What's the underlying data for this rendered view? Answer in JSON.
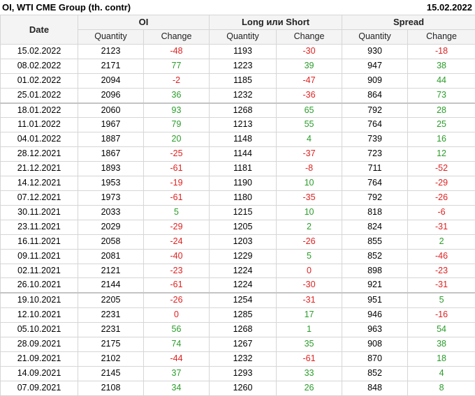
{
  "header": {
    "title": "OI, WTI CME Group (th. contr)",
    "date": "15.02.2022"
  },
  "table": {
    "date_header": "Date",
    "groups": [
      "OI",
      "Long или Short",
      "Spread"
    ],
    "sub_headers": [
      "Quantity",
      "Change",
      "Quantity",
      "Change",
      "Quantity",
      "Change"
    ],
    "rows": [
      [
        "15.02.2022",
        "2123",
        "-48",
        "1193",
        "-30",
        "930",
        "-18"
      ],
      [
        "08.02.2022",
        "2171",
        "77",
        "1223",
        "39",
        "947",
        "38"
      ],
      [
        "01.02.2022",
        "2094",
        "-2",
        "1185",
        "-47",
        "909",
        "44"
      ],
      [
        "25.01.2022",
        "2096",
        "36",
        "1232",
        "-36",
        "864",
        "73"
      ],
      [
        "18.01.2022",
        "2060",
        "93",
        "1268",
        "65",
        "792",
        "28"
      ],
      [
        "11.01.2022",
        "1967",
        "79",
        "1213",
        "55",
        "764",
        "25"
      ],
      [
        "04.01.2022",
        "1887",
        "20",
        "1148",
        "4",
        "739",
        "16"
      ],
      [
        "28.12.2021",
        "1867",
        "-25",
        "1144",
        "-37",
        "723",
        "12"
      ],
      [
        "21.12.2021",
        "1893",
        "-61",
        "1181",
        "-8",
        "711",
        "-52"
      ],
      [
        "14.12.2021",
        "1953",
        "-19",
        "1190",
        "10",
        "764",
        "-29"
      ],
      [
        "07.12.2021",
        "1973",
        "-61",
        "1180",
        "-35",
        "792",
        "-26"
      ],
      [
        "30.11.2021",
        "2033",
        "5",
        "1215",
        "10",
        "818",
        "-6"
      ],
      [
        "23.11.2021",
        "2029",
        "-29",
        "1205",
        "2",
        "824",
        "-31"
      ],
      [
        "16.11.2021",
        "2058",
        "-24",
        "1203",
        "-26",
        "855",
        "2"
      ],
      [
        "09.11.2021",
        "2081",
        "-40",
        "1229",
        "5",
        "852",
        "-46"
      ],
      [
        "02.11.2021",
        "2121",
        "-23",
        "1224",
        "0",
        "898",
        "-23"
      ],
      [
        "26.10.2021",
        "2144",
        "-61",
        "1224",
        "-30",
        "921",
        "-31"
      ],
      [
        "19.10.2021",
        "2205",
        "-26",
        "1254",
        "-31",
        "951",
        "5"
      ],
      [
        "12.10.2021",
        "2231",
        "0",
        "1285",
        "17",
        "946",
        "-16"
      ],
      [
        "05.10.2021",
        "2231",
        "56",
        "1268",
        "1",
        "963",
        "54"
      ],
      [
        "28.09.2021",
        "2175",
        "74",
        "1267",
        "35",
        "908",
        "38"
      ],
      [
        "21.09.2021",
        "2102",
        "-44",
        "1232",
        "-61",
        "870",
        "18"
      ],
      [
        "14.09.2021",
        "2145",
        "37",
        "1293",
        "33",
        "852",
        "4"
      ],
      [
        "07.09.2021",
        "2108",
        "34",
        "1260",
        "26",
        "848",
        "8"
      ]
    ],
    "separator_after_rows": [
      3,
      16
    ]
  },
  "colors": {
    "positive": "#2a9c2a",
    "negative": "#e02020",
    "header_bg": "#f4f4f4",
    "grid": "#d6d6d6"
  }
}
